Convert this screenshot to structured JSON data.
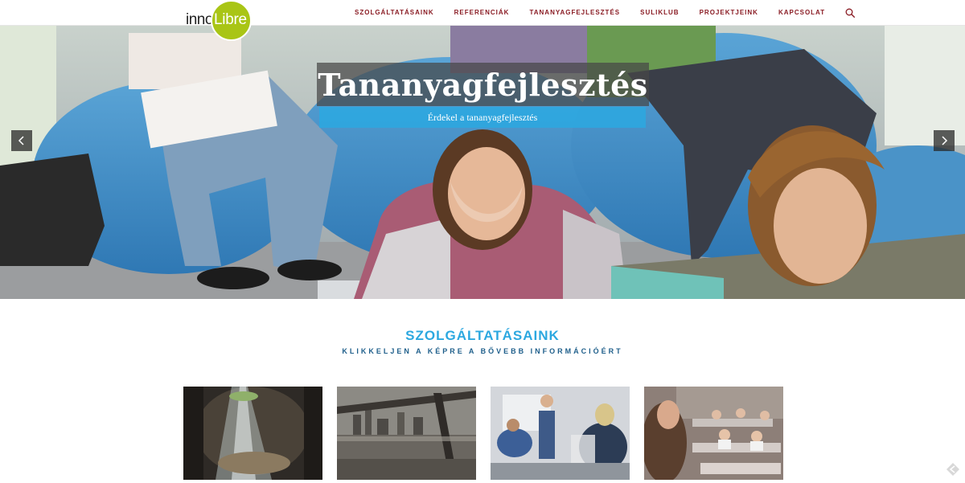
{
  "header": {
    "logo": {
      "part1": "inno",
      "part2": "Libre",
      "circle_color": "#a9c515"
    },
    "nav": [
      {
        "label": "SZOLGÁLTATÁSAINK"
      },
      {
        "label": "REFERENCIÁK"
      },
      {
        "label": "TANANYAGFEJLESZTÉS"
      },
      {
        "label": "SULIKLUB"
      },
      {
        "label": "PROJEKTJEINK"
      },
      {
        "label": "KAPCSOLAT"
      }
    ],
    "nav_color": "#8a1c24",
    "search_icon": "search-icon"
  },
  "hero": {
    "title": "Tananyagfejlesztés",
    "subtitle": "Érdekel a tananyagfejlesztés",
    "prev_icon": "chevron-left-icon",
    "next_icon": "chevron-right-icon",
    "accent_color": "#2ca8e0"
  },
  "services": {
    "title": "SZOLGÁLTATÁSAINK",
    "subtitle": "KLIKKELJEN A KÉPRE A BŐVEBB INFORMÁCIÓÉRT",
    "title_color": "#2ca8e0",
    "thumbnails": [
      {
        "icon": "cave-light-image"
      },
      {
        "icon": "bridge-city-image"
      },
      {
        "icon": "classroom-presentation-image"
      },
      {
        "icon": "classroom-students-image"
      }
    ]
  }
}
